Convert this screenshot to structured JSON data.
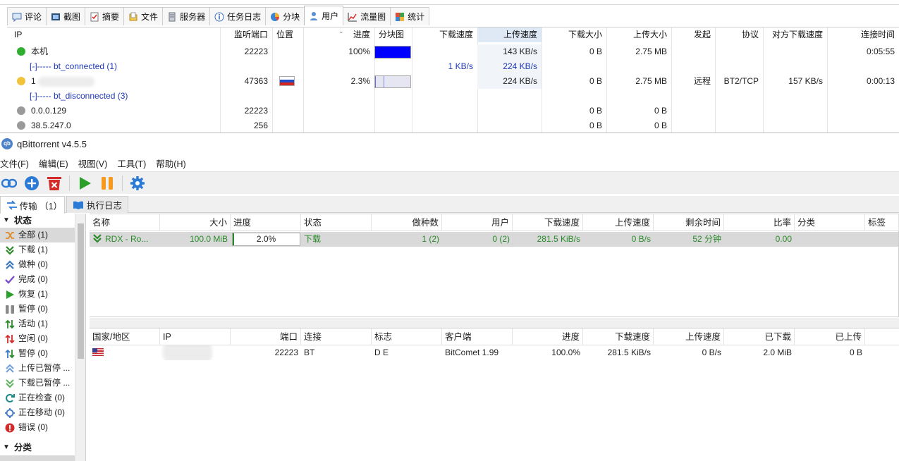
{
  "bitcomet": {
    "tabs": [
      {
        "label": "评论",
        "icon": "comment-icon"
      },
      {
        "label": "截图",
        "icon": "screenshot-icon"
      },
      {
        "label": "摘要",
        "icon": "summary-icon"
      },
      {
        "label": "文件",
        "icon": "file-icon"
      },
      {
        "label": "服务器",
        "icon": "server-icon"
      },
      {
        "label": "任务日志",
        "icon": "info-icon"
      },
      {
        "label": "分块",
        "icon": "pie-icon"
      },
      {
        "label": "用户",
        "icon": "user-icon"
      },
      {
        "label": "流量图",
        "icon": "chart-icon"
      },
      {
        "label": "统计",
        "icon": "stats-icon"
      }
    ],
    "active_tab": "用户",
    "columns": [
      "IP",
      "监听端口",
      "位置",
      "进度",
      "分块图",
      "下载速度",
      "上传速度",
      "下载大小",
      "上传大小",
      "发起",
      "协议",
      "对方下载速度",
      "连接时间"
    ],
    "rows": [
      {
        "ip": "本机",
        "port": "22223",
        "progress": "100%",
        "pieces_fill": 1.0,
        "down_speed": "",
        "up_speed": "143 KB/s",
        "down_size": "0 B",
        "up_size": "2.75 MB",
        "initiator": "",
        "protocol": "",
        "peer_down": "",
        "conn_time": "0:05:55",
        "status": "green"
      },
      {
        "group": "[-]----- bt_connected (1)",
        "down_speed": "1 KB/s",
        "up_speed": "224 KB/s"
      },
      {
        "ip": "1",
        "port": "47363",
        "progress": "2.3%",
        "pieces_fill": 0.023,
        "down_speed": "",
        "up_speed": "224 KB/s",
        "down_size": "0 B",
        "up_size": "2.75 MB",
        "initiator": "远程",
        "protocol": "BT2/TCP",
        "peer_down": "157 KB/s",
        "conn_time": "0:00:13",
        "status": "yellow",
        "flag": "ru"
      },
      {
        "group": "[-]----- bt_disconnected (3)"
      },
      {
        "ip": "0.0.0.129",
        "port": "22223",
        "down_size": "0 B",
        "up_size": "0 B",
        "status": "gray"
      },
      {
        "ip": "38.5.247.0",
        "port": "256",
        "down_size": "0 B",
        "up_size": "0 B",
        "status": "gray"
      }
    ]
  },
  "qbittorrent": {
    "title": "qBittorrent v4.5.5",
    "logo_text": "qb",
    "menu": [
      "文件(F)",
      "编辑(E)",
      "视图(V)",
      "工具(T)",
      "帮助(H)"
    ],
    "toolbar": [
      "link-icon",
      "add-icon",
      "delete-icon",
      "resume-icon",
      "pause-icon",
      "gear-icon"
    ],
    "panel_tabs": [
      {
        "label": "传输 （1）",
        "icon": "transfer-icon"
      },
      {
        "label": "执行日志",
        "icon": "book-icon"
      }
    ],
    "sidebar": {
      "status_header": "状态",
      "items": [
        {
          "label": "全部 (1)",
          "icon": "shuffle-icon",
          "color": "#e08a2e",
          "selected": true
        },
        {
          "label": "下载 (1)",
          "icon": "download-icon",
          "color": "#2a8a2a"
        },
        {
          "label": "做种 (0)",
          "icon": "seed-icon",
          "color": "#3a78c8"
        },
        {
          "label": "完成 (0)",
          "icon": "check-icon",
          "color": "#7b4fc8"
        },
        {
          "label": "恢复 (1)",
          "icon": "play-icon",
          "color": "#2aa02a"
        },
        {
          "label": "暂停 (0)",
          "icon": "pause-icon",
          "color": "#8a8a8a"
        },
        {
          "label": "活动 (1)",
          "icon": "updown-icon",
          "color": "#2a8a2a"
        },
        {
          "label": "空闲 (0)",
          "icon": "updown-red-icon",
          "color": "#d42a2a"
        },
        {
          "label": "暂停 (0)",
          "icon": "updown-blue-icon",
          "color": "#3a78c8"
        },
        {
          "label": "上传已暂停 ...",
          "icon": "seed-paused-icon",
          "color": "#3a78c8"
        },
        {
          "label": "下载已暂停 ...",
          "icon": "download-paused-icon",
          "color": "#2a8a2a"
        },
        {
          "label": "正在检查 (0)",
          "icon": "refresh-icon",
          "color": "#1a8a8a"
        },
        {
          "label": "正在移动 (0)",
          "icon": "move-icon",
          "color": "#3a78c8"
        },
        {
          "label": "错误 (0)",
          "icon": "error-icon",
          "color": "#d42a2a"
        }
      ],
      "category_header": "分类"
    },
    "transfer_columns": [
      "名称",
      "大小",
      "进度",
      "状态",
      "做种数",
      "用户",
      "下载速度",
      "上传速度",
      "剩余时间",
      "比率",
      "分类",
      "标签"
    ],
    "torrent": {
      "name": "RDX - Ro...",
      "size": "100.0 MiB",
      "progress": "2.0%",
      "progress_value": 0.02,
      "status": "下载",
      "seeds": "1 (2)",
      "peers": "0 (2)",
      "down_speed": "281.5 KiB/s",
      "up_speed": "0 B/s",
      "eta": "52 分钟",
      "ratio": "0.00",
      "category": "",
      "tags": ""
    },
    "peer_columns": [
      "国家/地区",
      "IP",
      "端口",
      "连接",
      "标志",
      "客户端",
      "进度",
      "下载速度",
      "上传速度",
      "已下载",
      "已上传"
    ],
    "peer": {
      "country": "us",
      "ip": "",
      "port": "22223",
      "connection": "BT",
      "flags": "D E",
      "client": "BitComet 1.99",
      "progress": "100.0%",
      "down_speed": "281.5 KiB/s",
      "up_speed": "0 B/s",
      "downloaded": "2.0 MiB",
      "uploaded": "0 B"
    }
  }
}
